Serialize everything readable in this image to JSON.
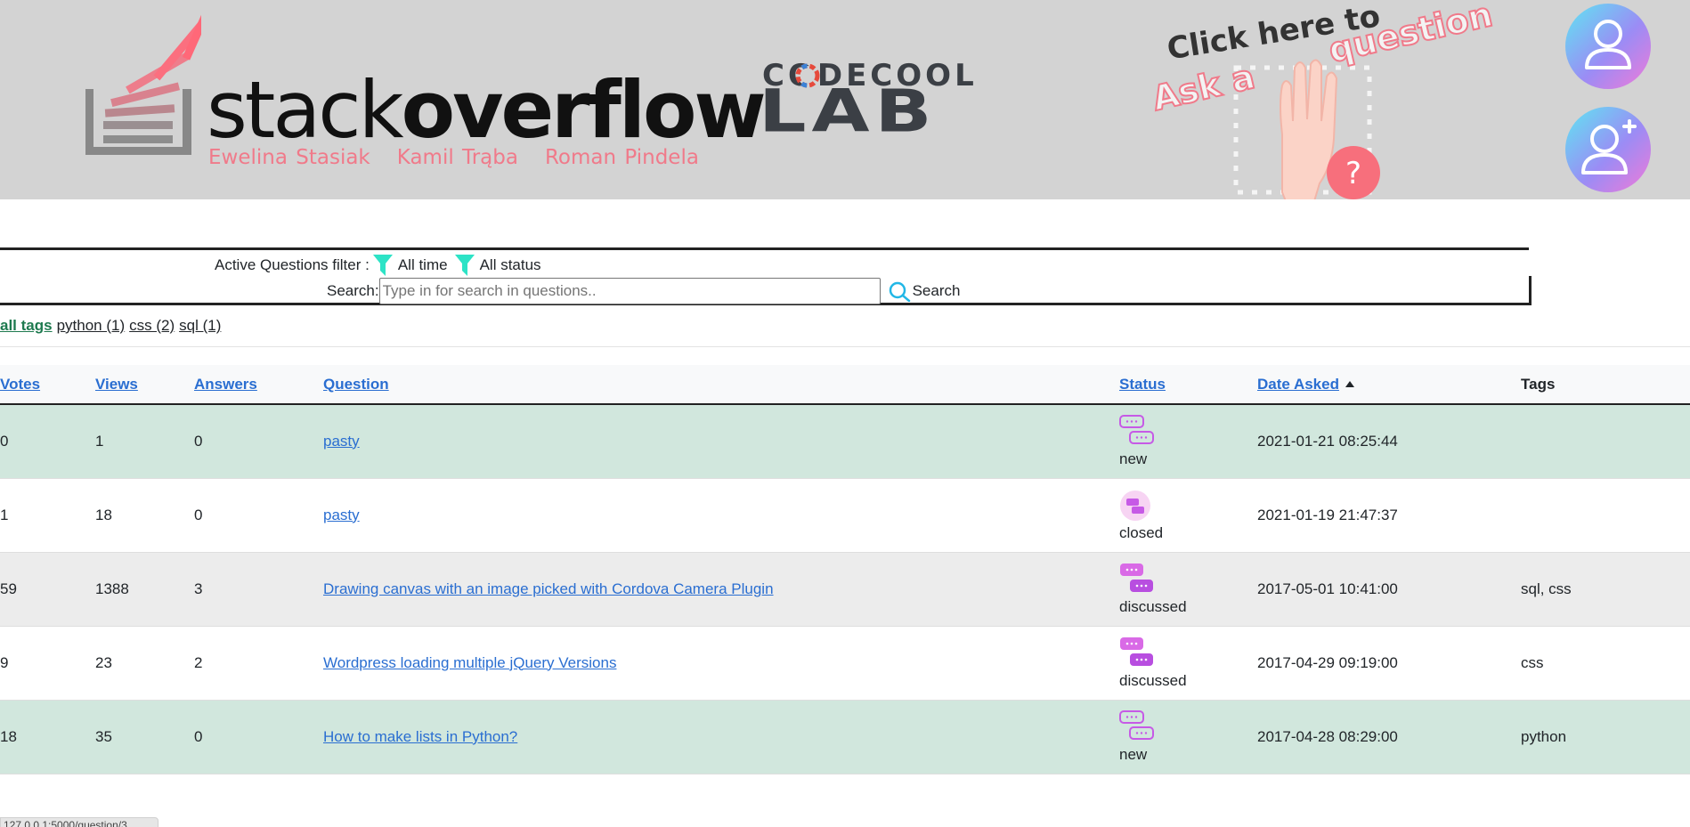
{
  "banner": {
    "logo_word_light": "stack",
    "logo_word_bold": "overflow",
    "authors": [
      "Ewelina Stasiak",
      "Kamil Trąba",
      "Roman Pindela"
    ],
    "codecool_top": "CODECOOL",
    "codecool_lab": "LAB",
    "ask_click_text": "Click here to",
    "ask_a_text": "Ask a",
    "ask_question_text": "question",
    "brand_color": "#f07a8a"
  },
  "filter": {
    "label": "Active Questions filter :",
    "time_filter": "All time",
    "status_filter": "All status"
  },
  "search": {
    "label": "Search:",
    "placeholder": "Type in for search in questions..",
    "button_label": "Search"
  },
  "tags": {
    "all_label": "all tags",
    "items": [
      {
        "label": "python (1)"
      },
      {
        "label": "css (2)"
      },
      {
        "label": "sql (1)"
      }
    ]
  },
  "table": {
    "headers": {
      "votes": "Votes",
      "views": "Views",
      "answers": "Answers",
      "question": "Question",
      "status": "Status",
      "date": "Date Asked",
      "tags": "Tags"
    },
    "rows": [
      {
        "votes": "0",
        "views": "1",
        "answers": "0",
        "question": "pasty",
        "status": "new",
        "date": "2021-01-21 08:25:44",
        "tags": ""
      },
      {
        "votes": "1",
        "views": "18",
        "answers": "0",
        "question": "pasty",
        "status": "closed",
        "date": "2021-01-19 21:47:37",
        "tags": ""
      },
      {
        "votes": "59",
        "views": "1388",
        "answers": "3",
        "question": "Drawing canvas with an image picked with Cordova Camera Plugin",
        "status": "discussed",
        "date": "2017-05-01 10:41:00",
        "tags": "sql, css"
      },
      {
        "votes": "9",
        "views": "23",
        "answers": "2",
        "question": "Wordpress loading multiple jQuery Versions",
        "status": "discussed",
        "date": "2017-04-29 09:19:00",
        "tags": "css"
      },
      {
        "votes": "18",
        "views": "35",
        "answers": "0",
        "question": "How to make lists in Python?",
        "status": "new",
        "date": "2017-04-28 08:29:00",
        "tags": "python"
      }
    ]
  },
  "colors": {
    "link": "#2a6ed1",
    "new_row": "#d1e7dd",
    "funnel": "#2de3c6",
    "status_icon": "#c65ae6"
  },
  "url_hint": "127.0.0.1:5000/question/3"
}
